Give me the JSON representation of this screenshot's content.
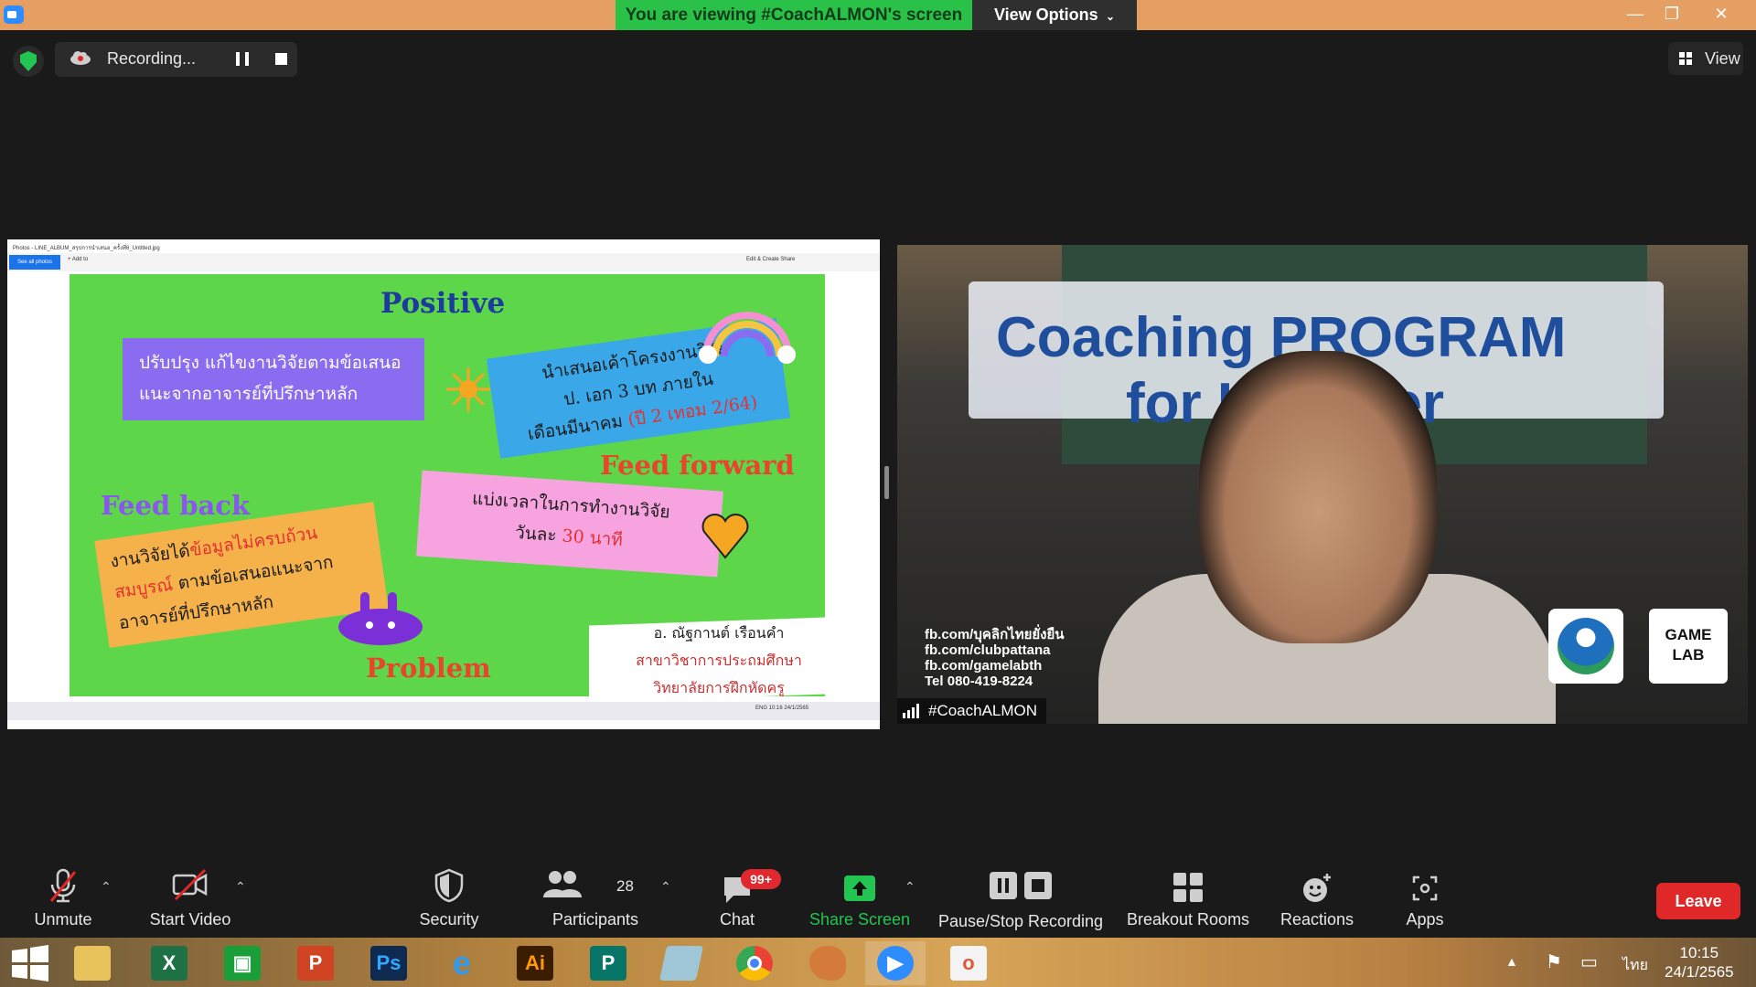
{
  "window": {
    "banner": "You are viewing #CoachALMON's screen",
    "view_options": "View Options",
    "minimize": "—",
    "restore": "❐",
    "close": "✕"
  },
  "recording": {
    "label": "Recording...",
    "view_label": "View"
  },
  "shared_screen": {
    "photos_title": "Photos - LINE_ALBUM_สรุปการนำเสนอ_ครั้งที่6_Untitled.jpg",
    "see_all": "See all photos",
    "add_to": "+ Add to",
    "tools_right": "Edit & Create   Share",
    "taskbar_right": "ENG  10:16  24/1/2565",
    "slide": {
      "positive": "Positive",
      "feedback": "Feed back",
      "feed_forward": "Feed forward",
      "problem": "Problem",
      "purple_box_line1": "ปรับปรุง แก้ไขงานวิจัยตามข้อเสนอ",
      "purple_box_line2": "แนะจากอาจารย์ที่ปรึกษาหลัก",
      "blue_box_line1": "นำเสนอเค้าโครงงานวิจัย",
      "blue_box_line2": "ป. เอก 3 บท ภายใน",
      "blue_box_line3a": "เดือนมีนาคม ",
      "blue_box_line3b": "(ปี 2 เทอม 2/64)",
      "orange_box_line1a": "งานวิจัยได้",
      "orange_box_line1b": "ข้อมูลไม่ครบถ้วน",
      "orange_box_line2a": "สมบูรณ์",
      "orange_box_line2b": " ตามข้อเสนอแนะจาก",
      "orange_box_line3": "อาจารย์ที่ปรึกษาหลัก",
      "pink_box_line1": "แบ่งเวลาในการทำงานวิจัย",
      "pink_box_line2a": "วันละ ",
      "pink_box_line2b": "30 นาที",
      "sign_name": "อ. ณัฐกานต์ เรือนคำ",
      "sign_dept": "สาขาวิชาการประถมศึกษา",
      "sign_school": "วิทยาลัยการฝึกหัดครู"
    }
  },
  "video": {
    "title_line1": "Coaching PROGRAM",
    "title_line2": "for Lecturer",
    "fb_lines": [
      "fb.com/บุคลิกไทยยั่งยืน",
      "fb.com/clubpattana",
      "fb.com/gamelabth",
      "Tel 080-419-8224"
    ],
    "logo_text": "GAME LAB",
    "participant_name": "#CoachALMON"
  },
  "toolbar": {
    "unmute": "Unmute",
    "start_video": "Start Video",
    "security": "Security",
    "participants": "Participants",
    "participants_count": "28",
    "chat": "Chat",
    "chat_badge": "99+",
    "share_screen": "Share Screen",
    "pause_stop": "Pause/Stop Recording",
    "breakout": "Breakout Rooms",
    "reactions": "Reactions",
    "apps": "Apps",
    "leave": "Leave"
  },
  "taskbar": {
    "apps": [
      "Start",
      "File Explorer",
      "Excel",
      "Store",
      "PowerPoint",
      "Photoshop",
      "Internet Explorer",
      "Illustrator",
      "Publisher",
      "Notepad",
      "Chrome",
      "Paint",
      "Zoom",
      "Photos"
    ],
    "lang": "ไทย",
    "time": "10:15",
    "date": "24/1/2565"
  },
  "colors": {
    "titlebar": "#e59f63",
    "banner_green": "#2ac148",
    "leave_red": "#e02828",
    "share_green": "#23c552"
  }
}
